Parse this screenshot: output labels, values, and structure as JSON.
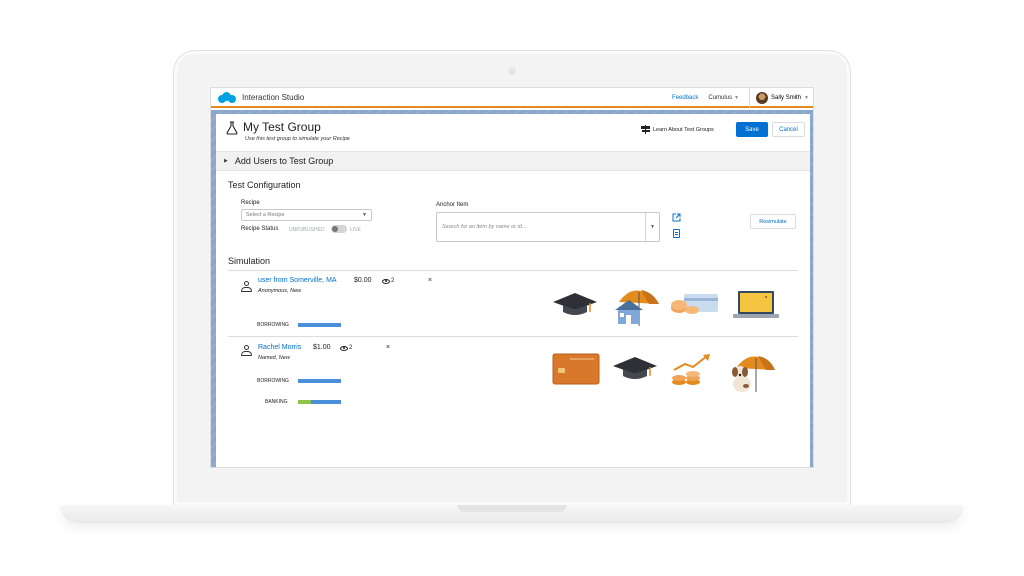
{
  "header": {
    "app_name": "Interaction Studio",
    "feedback_label": "Feedback",
    "account_label": "Cumulus",
    "user_name": "Sally Smith"
  },
  "page": {
    "title": "My Test Group",
    "subtitle": "Use this test group to simulate your Recipe",
    "learn_label": "Learn About Test Groups",
    "save_label": "Save",
    "cancel_label": "Cancel"
  },
  "add_users": {
    "label": "Add Users to Test Group"
  },
  "config": {
    "heading": "Test Configuration",
    "recipe_label": "Recipe",
    "recipe_placeholder": "Select a Recipe",
    "status_label": "Recipe Status",
    "status_off": "UNPUBLISHED",
    "status_on": "LIVE",
    "anchor_label": "Anchor Item",
    "anchor_placeholder": "Search for an item by name or id...",
    "resimulate_label": "Resimulate"
  },
  "simulation": {
    "heading": "Simulation",
    "users": [
      {
        "name": "user from Somerville, MA",
        "type": "Anonymous, New",
        "amount": "$0.00",
        "views": "2",
        "remove": "×",
        "segments": [
          {
            "label": "BORROWING",
            "fill": 1.0,
            "green": 0.0
          }
        ],
        "items": [
          "graduation-cap",
          "house-umbrella",
          "coins-card",
          "laptop"
        ]
      },
      {
        "name": "Rachel Morris",
        "type": "Named, New",
        "amount": "$1.00",
        "views": "2",
        "remove": "×",
        "segments": [
          {
            "label": "BORROWING",
            "fill": 1.0,
            "green": 0.0
          },
          {
            "label": "BANKING",
            "fill": 1.0,
            "green": 0.3
          }
        ],
        "items": [
          "credit-card",
          "graduation-cap",
          "growth-coins",
          "dog-umbrella"
        ]
      }
    ]
  },
  "colors": {
    "brand_blue": "#0070d2",
    "accent_orange": "#e38b1c",
    "bar_blue": "#4a90d9",
    "bar_green": "#8fc14b"
  }
}
